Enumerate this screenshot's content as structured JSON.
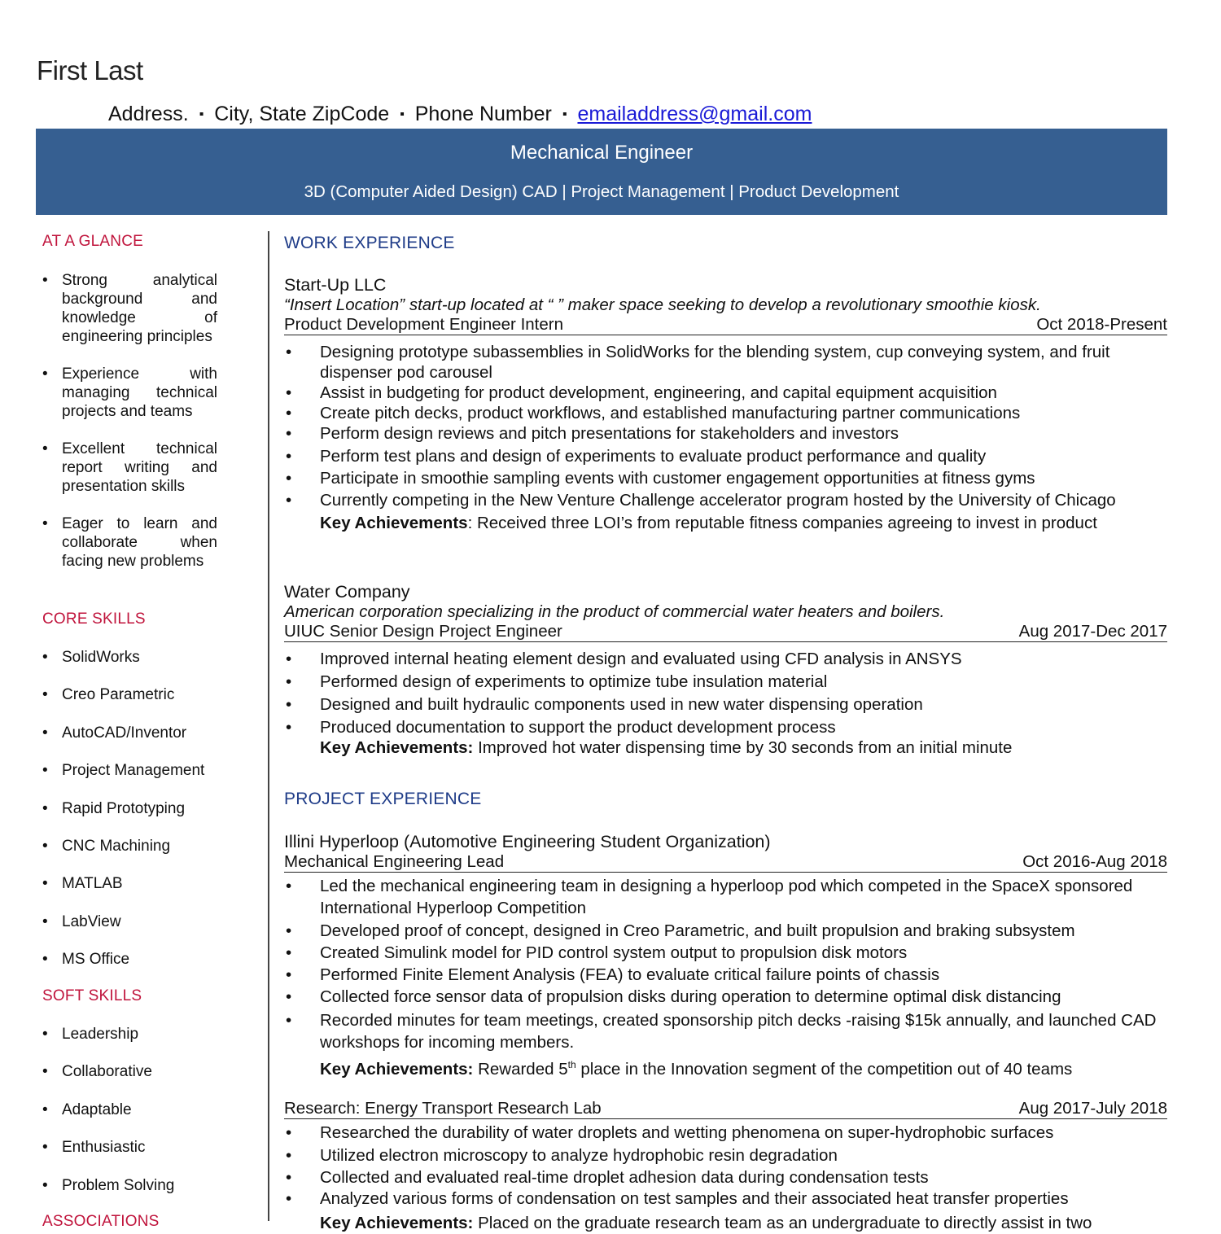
{
  "header": {
    "name": "First Last",
    "address": "Address.",
    "city_state_zip": "City, State  ZipCode",
    "phone": "Phone Number",
    "email": "emailaddress@gmail.com",
    "separator": "▪"
  },
  "banner": {
    "title": "Mechanical Engineer",
    "subtitle": "3D (Computer Aided Design) CAD | Project Management | Product Development",
    "color": "#365f91"
  },
  "sidebar": {
    "heading_color": "#c0143c",
    "at_a_glance": {
      "heading": "AT A GLANCE",
      "items": [
        "Strong analytical background and knowledge of engineering principles",
        "Experience with managing technical projects and teams",
        "Excellent technical report writing and presentation skills",
        "Eager to learn and collaborate when facing new problems"
      ]
    },
    "core_skills": {
      "heading": "CORE SKILLS",
      "items": [
        "SolidWorks",
        "Creo Parametric",
        "AutoCAD/Inventor",
        "Project Management",
        "Rapid Prototyping",
        "CNC Machining",
        "MATLAB",
        "LabView",
        "MS Office"
      ]
    },
    "soft_skills": {
      "heading": "SOFT SKILLS",
      "items": [
        "Leadership",
        "Collaborative",
        "Adaptable",
        "Enthusiastic",
        "Problem Solving"
      ]
    },
    "associations": {
      "heading": "ASSOCIATIONS"
    }
  },
  "work_experience": {
    "heading": "WORK EXPERIENCE",
    "jobs": [
      {
        "org": "Start-Up LLC",
        "desc": "“Insert Location” start-up located at “  ” maker space seeking to develop a revolutionary smoothie kiosk.",
        "role": "Product Development Engineer Intern",
        "dates": "Oct 2018-Present",
        "bullets": [
          "Designing prototype subassemblies in SolidWorks for the blending system, cup conveying system, and fruit dispenser pod carousel",
          "Assist in budgeting for product development, engineering, and capital equipment acquisition",
          "Create pitch decks, product workflows, and established manufacturing partner communications",
          "Perform design reviews and pitch presentations for stakeholders and investors",
          "Perform test plans and design of experiments to evaluate product performance and quality",
          "Participate in smoothie sampling events with customer engagement opportunities at fitness gyms",
          "Currently competing in the New Venture Challenge accelerator program hosted by the University of Chicago"
        ],
        "key_label": "Key Achievements",
        "key_text": ": Received three LOI’s from reputable fitness companies agreeing to invest in product"
      },
      {
        "org": "Water Company",
        "desc": "American corporation specializing in the product of commercial water heaters and boilers.",
        "role": "UIUC Senior Design Project Engineer",
        "dates": "Aug 2017-Dec 2017",
        "bullets": [
          "Improved internal heating element design and evaluated using CFD analysis in ANSYS",
          "Performed design of experiments to optimize tube insulation material",
          "Designed and built hydraulic components used in new water dispensing operation",
          "Produced documentation to support the product development process"
        ],
        "key_label": "Key Achievements:",
        "key_text": " Improved hot water dispensing time by 30 seconds from an initial minute"
      }
    ]
  },
  "project_experience": {
    "heading": "PROJECT EXPERIENCE",
    "projects": [
      {
        "org": "Illini Hyperloop (Automotive Engineering Student Organization)",
        "role": "Mechanical Engineering Lead",
        "dates": "Oct 2016-Aug 2018",
        "bullets": [
          "Led the mechanical engineering team in designing a hyperloop pod which competed in the SpaceX sponsored International Hyperloop Competition",
          "Developed proof of concept, designed in Creo Parametric, and built propulsion and braking subsystem",
          "Created Simulink model for PID control system output to propulsion disk motors",
          "Performed Finite Element Analysis (FEA) to evaluate critical failure points of chassis",
          "Collected force sensor data of propulsion disks during operation to determine optimal disk distancing",
          "Recorded minutes for team meetings, created sponsorship pitch decks -raising $15k annually, and launched CAD workshops for incoming members."
        ],
        "key_label": "Key Achievements:",
        "key_pre": " Rewarded 5",
        "key_sup": "th",
        "key_post": " place in the Innovation segment of the competition out of 40 teams"
      },
      {
        "role": "Research: Energy Transport Research Lab",
        "dates": "Aug 2017-July 2018",
        "bullets": [
          "Researched the durability of water droplets and wetting phenomena on super-hydrophobic surfaces",
          "Utilized electron microscopy to analyze hydrophobic resin degradation",
          "Collected and evaluated real-time droplet adhesion data during condensation tests",
          "Analyzed various forms of condensation on test samples and their associated heat transfer properties"
        ],
        "key_label": "Key Achievements:",
        "key_text": " Placed on the graduate research team as an undergraduate to directly assist in two"
      }
    ]
  }
}
